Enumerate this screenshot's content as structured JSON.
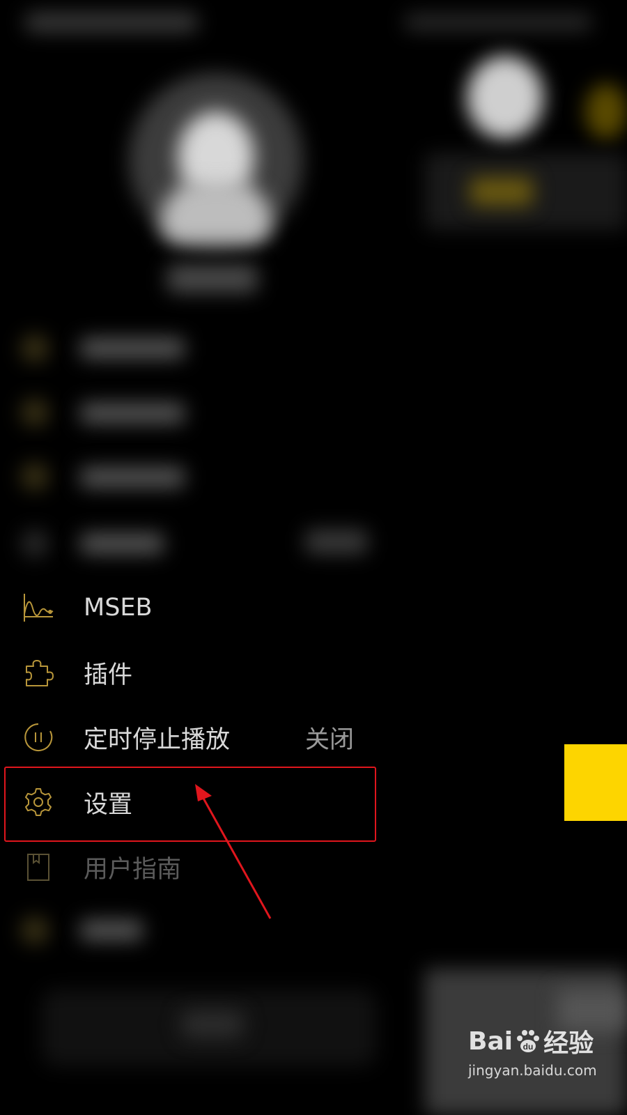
{
  "menu": {
    "items": [
      {
        "label": "MSEB",
        "icon": "waveform-icon"
      },
      {
        "label": "插件",
        "icon": "puzzle-icon"
      },
      {
        "label": "定时停止播放",
        "value": "关闭",
        "icon": "timer-icon"
      },
      {
        "label": "设置",
        "icon": "gear-icon"
      },
      {
        "label": "用户指南",
        "icon": "book-icon"
      }
    ]
  },
  "watermark": {
    "brand": "Bai",
    "brand_suffix": "经验",
    "url": "jingyan.baidu.com"
  },
  "colors": {
    "accent_gold": "#b8963a",
    "highlight_red": "#e0161d",
    "yellow_tab": "#fdd500"
  }
}
